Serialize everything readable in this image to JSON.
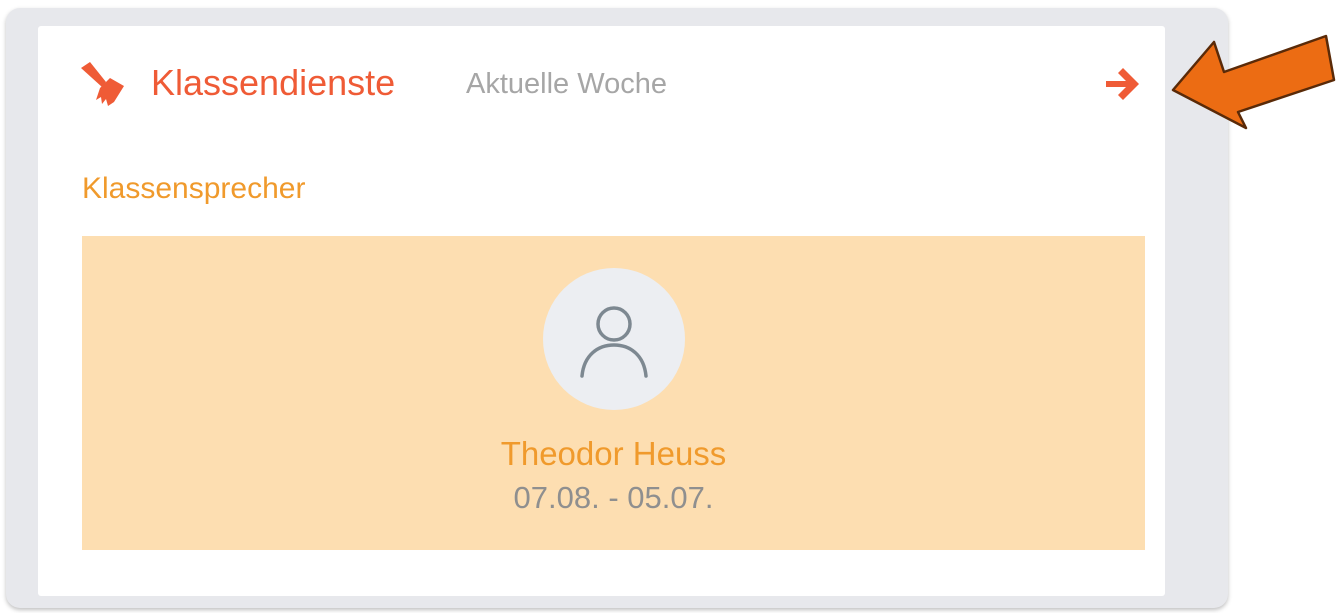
{
  "widget": {
    "title": "Klassendienste",
    "subtitle": "Aktuelle Woche",
    "icon": "broom-icon",
    "nav_icon": "arrow-right-icon",
    "accent_color": "#ef5b36"
  },
  "duty": {
    "role": "Klassensprecher",
    "person_name": "Theodor Heuss",
    "date_range": "07.08. - 05.07.",
    "avatar_icon": "user-icon",
    "panel_color": "#fddeb1",
    "name_color": "#f09a2c"
  },
  "annotation": {
    "icon": "callout-arrow-icon",
    "color": "#ec6c13"
  }
}
